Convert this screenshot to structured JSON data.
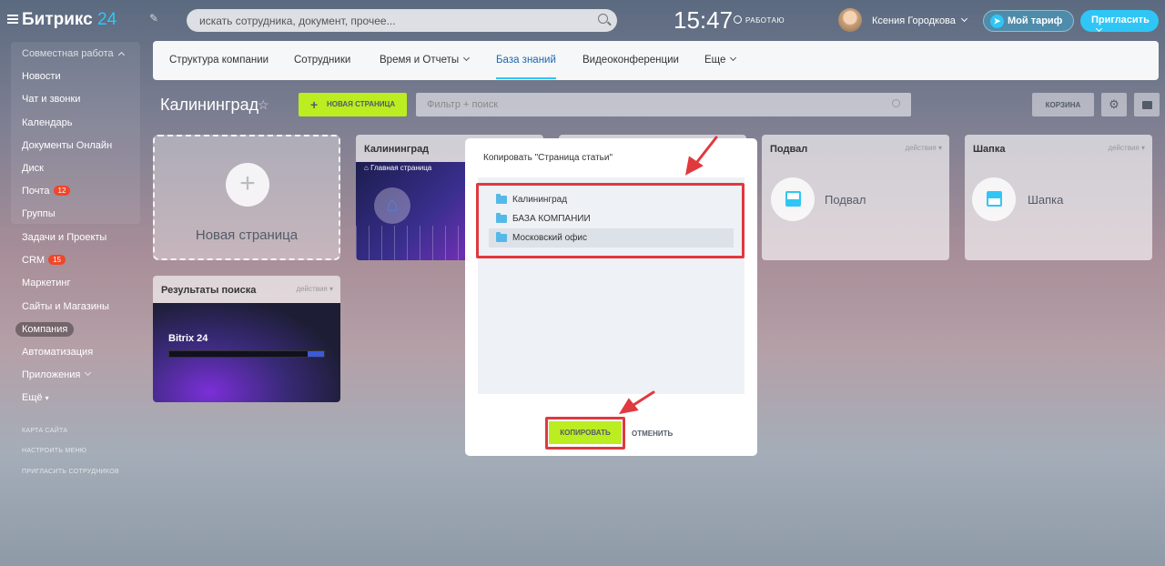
{
  "header": {
    "logo_main": "Битрикс",
    "logo_suffix": "24",
    "search_placeholder": "искать сотрудника, документ, прочее...",
    "time": "15:47",
    "work_status": "РАБОТАЮ",
    "user_name": "Ксения Городкова",
    "tariff_label": "Мой тариф",
    "invite_label": "Пригласить"
  },
  "sidebar": {
    "section_title": "Совместная работа",
    "items": [
      {
        "label": "Новости"
      },
      {
        "label": "Чат и звонки"
      },
      {
        "label": "Календарь"
      },
      {
        "label": "Документы Онлайн"
      },
      {
        "label": "Диск"
      },
      {
        "label": "Почта",
        "badge": "12"
      },
      {
        "label": "Группы"
      },
      {
        "label": "Задачи и Проекты"
      },
      {
        "label": "CRM",
        "badge": "15"
      },
      {
        "label": "Маркетинг"
      },
      {
        "label": "Сайты и Магазины"
      },
      {
        "label": "Компания"
      },
      {
        "label": "Автоматизация"
      },
      {
        "label": "Приложения"
      },
      {
        "label": "Ещё"
      }
    ],
    "footer_links": [
      "КАРТА САЙТА",
      "НАСТРОИТЬ МЕНЮ",
      "ПРИГЛАСИТЬ СОТРУДНИКОВ"
    ]
  },
  "tabs": [
    "Структура компании",
    "Сотрудники",
    "Время и Отчеты",
    "База знаний",
    "Видеоконференции",
    "Еще"
  ],
  "page": {
    "title": "Калининград",
    "new_page_button": "НОВАЯ СТРАНИЦА",
    "filter_placeholder": "Фильтр + поиск",
    "trash_button": "КОРЗИНА"
  },
  "cards": {
    "new_page": "Новая страница",
    "kaliningrad": {
      "title": "Калининград",
      "preview_link": "Главная страница"
    },
    "podval": {
      "title": "Подвал",
      "actions": "действия",
      "label": "Подвал"
    },
    "shapka": {
      "title": "Шапка",
      "actions": "действия",
      "label": "Шапка"
    },
    "search_results": {
      "title": "Результаты поиска",
      "actions": "действия",
      "brand": "Bitrix 24"
    }
  },
  "modal": {
    "title": "Копировать \"Страница статьи\"",
    "folders": [
      "Калининград",
      "БАЗА КОМПАНИИ",
      "Московский офис"
    ],
    "selected_index": 2,
    "copy_button": "КОПИРОВАТЬ",
    "cancel_button": "ОТМЕНИТЬ"
  },
  "colors": {
    "accent": "#2fc6f6",
    "primary_button": "#bbed21",
    "highlight": "#e0393e"
  }
}
